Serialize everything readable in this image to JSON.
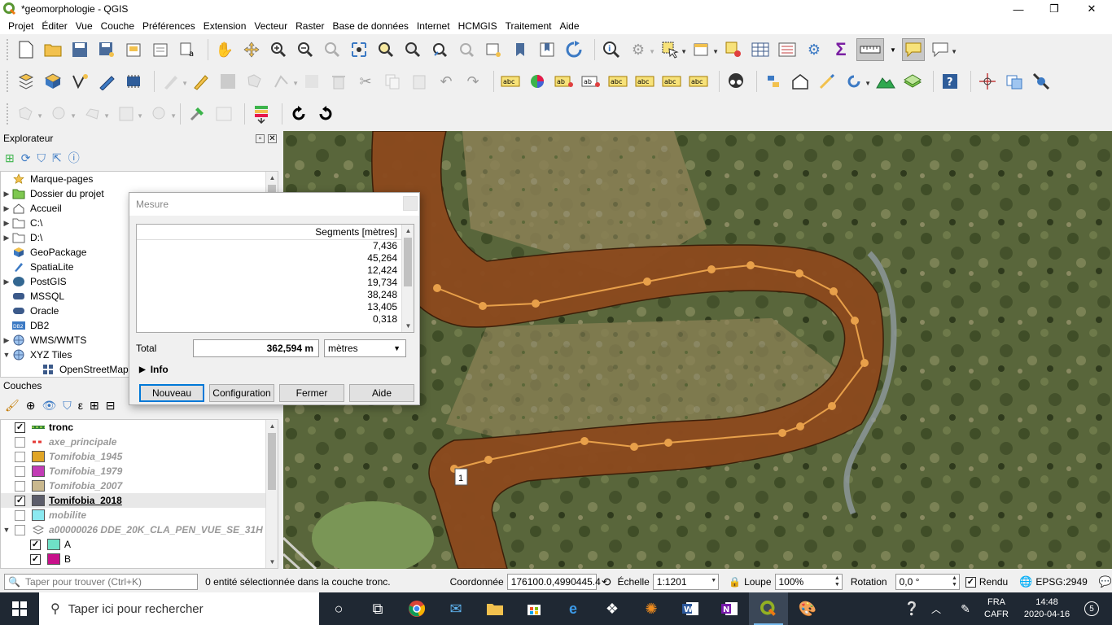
{
  "window": {
    "title": "*geomorphologie - QGIS",
    "minimize": "—",
    "maximize": "❐",
    "close": "✕"
  },
  "menu": [
    "Projet",
    "Éditer",
    "Vue",
    "Couche",
    "Préférences",
    "Extension",
    "Vecteur",
    "Raster",
    "Base de données",
    "Internet",
    "HCMGIS",
    "Traitement",
    "Aide"
  ],
  "explorer": {
    "title": "Explorateur",
    "items": [
      {
        "label": "Marque-pages",
        "icon": "star-icon",
        "arrow": ""
      },
      {
        "label": "Dossier du projet",
        "icon": "project-folder-icon",
        "arrow": "▶"
      },
      {
        "label": "Accueil",
        "icon": "home-folder-icon",
        "arrow": "▶"
      },
      {
        "label": "C:\\",
        "icon": "drive-icon",
        "arrow": "▶"
      },
      {
        "label": "D:\\",
        "icon": "drive-icon",
        "arrow": "▶"
      },
      {
        "label": "GeoPackage",
        "icon": "geopackage-icon",
        "arrow": ""
      },
      {
        "label": "SpatiaLite",
        "icon": "spatialite-icon",
        "arrow": ""
      },
      {
        "label": "PostGIS",
        "icon": "postgis-icon",
        "arrow": "▶"
      },
      {
        "label": "MSSQL",
        "icon": "mssql-icon",
        "arrow": ""
      },
      {
        "label": "Oracle",
        "icon": "oracle-icon",
        "arrow": ""
      },
      {
        "label": "DB2",
        "icon": "db2-icon",
        "arrow": ""
      },
      {
        "label": "WMS/WMTS",
        "icon": "globe-icon",
        "arrow": "▶"
      },
      {
        "label": "XYZ Tiles",
        "icon": "globe-icon",
        "arrow": "▼"
      },
      {
        "label": "OpenStreetMap",
        "icon": "tiles-icon",
        "arrow": ""
      }
    ]
  },
  "layers": {
    "title": "Couches",
    "items": [
      {
        "name": "tronc",
        "checked": true,
        "style": "on",
        "color": "#2e7d32",
        "symbol": "line"
      },
      {
        "name": "axe_principale",
        "checked": false,
        "style": "off",
        "color": "#e53935",
        "symbol": "dash"
      },
      {
        "name": "Tomifobia_1945",
        "checked": false,
        "style": "off",
        "color": "#e0a526",
        "symbol": "fill"
      },
      {
        "name": "Tomifobia_1979",
        "checked": false,
        "style": "off",
        "color": "#c23cb5",
        "symbol": "fill"
      },
      {
        "name": "Tomifobia_2007",
        "checked": false,
        "style": "off",
        "color": "#c9b88e",
        "symbol": "fill"
      },
      {
        "name": "Tomifobia_2018",
        "checked": true,
        "style": "on",
        "color": "#5c5d6a",
        "symbol": "fill"
      },
      {
        "name": "mobilite",
        "checked": false,
        "style": "off",
        "color": "#8be9f0",
        "symbol": "fill"
      },
      {
        "name": "a00000026 DDE_20K_CLA_PEN_VUE_SE_31H",
        "checked": false,
        "style": "off",
        "color": "",
        "symbol": "group"
      },
      {
        "name": "A",
        "checked": true,
        "style": "normal",
        "color": "#6fe0c6",
        "symbol": "fill"
      },
      {
        "name": "B",
        "checked": true,
        "style": "normal",
        "color": "#c8108a",
        "symbol": "fill"
      }
    ]
  },
  "measure": {
    "title": "Mesure",
    "header": "Segments [mètres]",
    "segments": [
      "7,436",
      "45,264",
      "12,424",
      "19,734",
      "38,248",
      "13,405",
      "0,318"
    ],
    "total_label": "Total",
    "total_value": "362,594 m",
    "unit": "mètres",
    "info_label": "Info",
    "buttons": {
      "new": "Nouveau",
      "config": "Configuration",
      "close": "Fermer",
      "help": "Aide"
    }
  },
  "map": {
    "vertex_label": "1"
  },
  "status": {
    "search_placeholder": "Taper pour trouver (Ctrl+K)",
    "message": "0 entité sélectionnée dans la couche tronc.",
    "coord_label": "Coordonnée",
    "coord_value": "176100.0,4990445.4",
    "scale_label": "Échelle",
    "scale_value": "1:1201",
    "magnifier_label": "Loupe",
    "magnifier_value": "100%",
    "rotation_label": "Rotation",
    "rotation_value": "0,0 °",
    "render_label": "Rendu",
    "crs": "EPSG:2949"
  },
  "taskbar": {
    "search_placeholder": "Taper ici pour rechercher",
    "lang_top": "FRA",
    "lang_bottom": "CAFR",
    "time": "14:48",
    "date": "2020-04-16",
    "notif_count": "5"
  }
}
